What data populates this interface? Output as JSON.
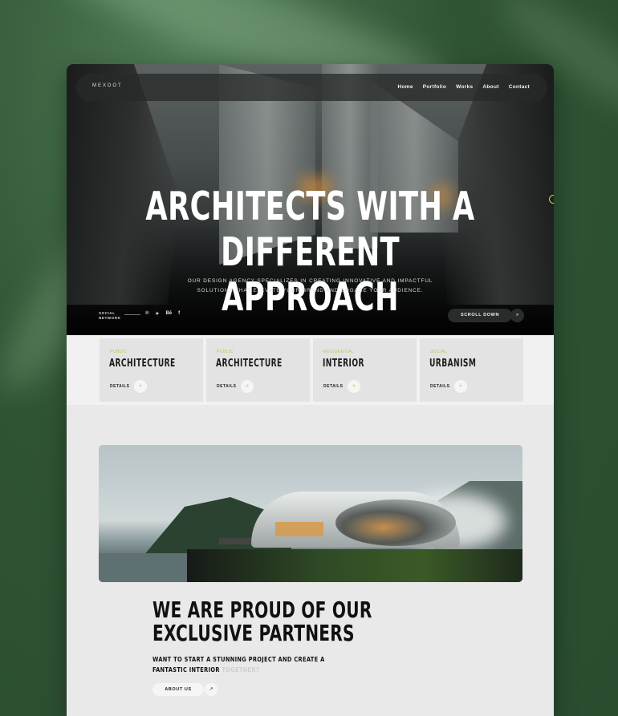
{
  "brand": "MEXDOT",
  "nav": [
    "Home",
    "Portfolio",
    "Works",
    "About",
    "Contact"
  ],
  "hero": {
    "line1": "ARCHITECTS WITH A",
    "line2": "DIFFERENT APPROACH",
    "sub1": "OUR DESIGN AGENCY SPECIALIZES IN CREATING INNOVATIVE AND IMPACTFUL",
    "sub2": "SOLUTIONS THAT ELEVATE YOUR BRAND AND ENGAGE YOUR AUDIENCE.",
    "social_label_1": "SOCIAL",
    "social_label_2": "NETWORK",
    "social_icons": [
      "pinterest-icon",
      "twitter-icon",
      "behance-icon",
      "facebook-icon"
    ],
    "social_glyphs": [
      "℗",
      "✦",
      "Bē",
      "f"
    ],
    "scroll_label": "SCROLL DOWN",
    "scroll_arrow": "»"
  },
  "services": [
    {
      "category": "PUBLIC",
      "title": "ARCHITECTURE",
      "details": "DETAILS",
      "arrow": "»"
    },
    {
      "category": "PUBLIC",
      "title": "ARCHITECTURE",
      "details": "DETAILS",
      "arrow": "»"
    },
    {
      "category": "RESIDENTIAL",
      "title": "INTERIOR",
      "details": "DETAILS",
      "arrow": "»"
    },
    {
      "category": "SOCIAL",
      "title": "URBANISM",
      "details": "DETAILS",
      "arrow": "»"
    }
  ],
  "partners": {
    "title1": "WE ARE PROUD OF OUR",
    "title2": "EXCLUSIVE PARTNERS",
    "cta1": "WANT TO START A STUNNING PROJECT AND CREATE A",
    "cta2": "FANTASTIC INTERIOR",
    "cta2_fade": "TOGETHER?",
    "button": "ABOUT US",
    "button_arrow": "↗"
  },
  "colors": {
    "accent": "#b7c94a",
    "background": "#2f5434",
    "card": "#e9e9e9"
  }
}
